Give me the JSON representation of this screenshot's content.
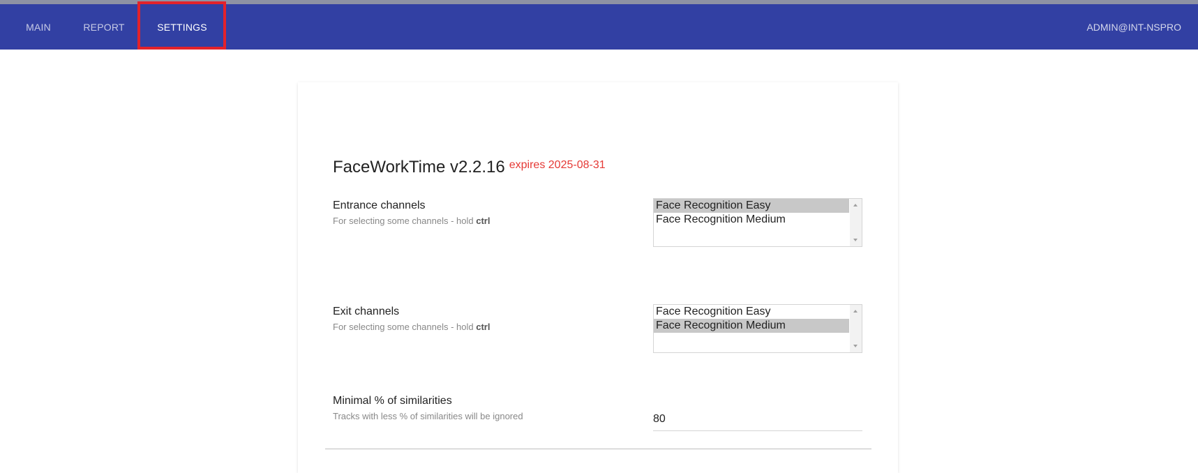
{
  "nav": {
    "tabs": [
      {
        "label": "MAIN"
      },
      {
        "label": "REPORT"
      },
      {
        "label": "SETTINGS"
      }
    ],
    "active_tab": "SETTINGS",
    "user": "ADMIN@INT-NSPRO"
  },
  "colors": {
    "navbar": "#3240a3",
    "highlight": "#e3222b",
    "expires": "#e53935"
  },
  "app": {
    "title": "FaceWorkTime v2.2.16",
    "expires": "expires 2025-08-31"
  },
  "settings": {
    "entrance": {
      "label": "Entrance channels",
      "hint": "For selecting some channels - hold ",
      "hint_key": "ctrl",
      "options": [
        "Face Recognition Easy",
        "Face Recognition Medium"
      ],
      "selected": "Face Recognition Easy"
    },
    "exit": {
      "label": "Exit channels",
      "hint": "For selecting some channels - hold ",
      "hint_key": "ctrl",
      "options": [
        "Face Recognition Easy",
        "Face Recognition Medium"
      ],
      "selected": "Face Recognition Medium"
    },
    "similarity": {
      "label": "Minimal % of similarities",
      "hint": "Tracks with less % of similarities will be ignored",
      "value": "80"
    }
  }
}
